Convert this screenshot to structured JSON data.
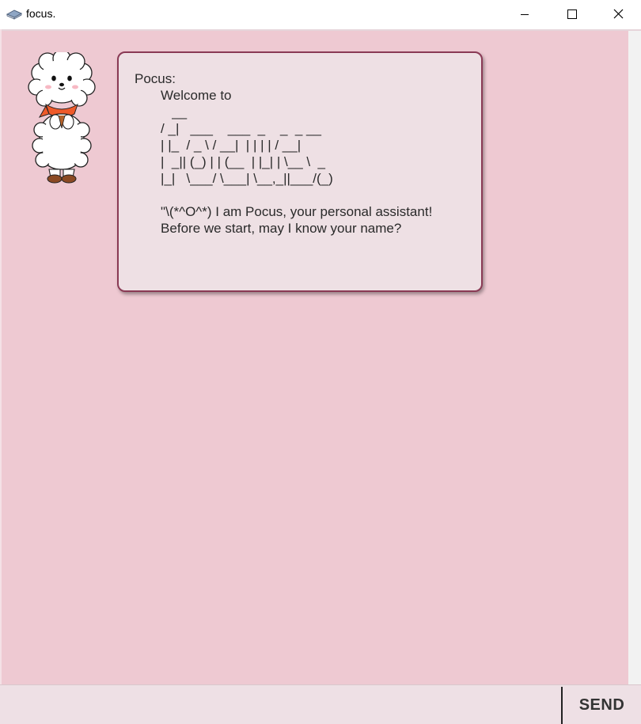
{
  "window": {
    "title": "focus.",
    "icon": "book-icon",
    "controls": [
      "minimize-icon",
      "maximize-icon",
      "close-icon"
    ]
  },
  "colors": {
    "chat_background": "#eec9d2",
    "bubble_background": "#eee0e4",
    "bubble_border": "#8a3a55",
    "input_background": "#eee0e5"
  },
  "chat": {
    "messages": [
      {
        "sender": "bot",
        "avatar": "sheep-mascot-icon",
        "text": "Pocus:\n       Welcome to\n          __\n       / _|   ___    ___  _    _  _ __\n       | |_  / _ \\ / __|  | | | | / __|\n       |  _|| (_) | | (__  | |_| | \\__ \\  _\n       |_|   \\___/ \\___| \\__,_||___/(_)\n\n       \"\\(*^O^*) I am Pocus, your personal assistant!\n       Before we start, may I know your name?"
      }
    ]
  },
  "input": {
    "value": "",
    "placeholder": "",
    "send_label": "SEND"
  }
}
